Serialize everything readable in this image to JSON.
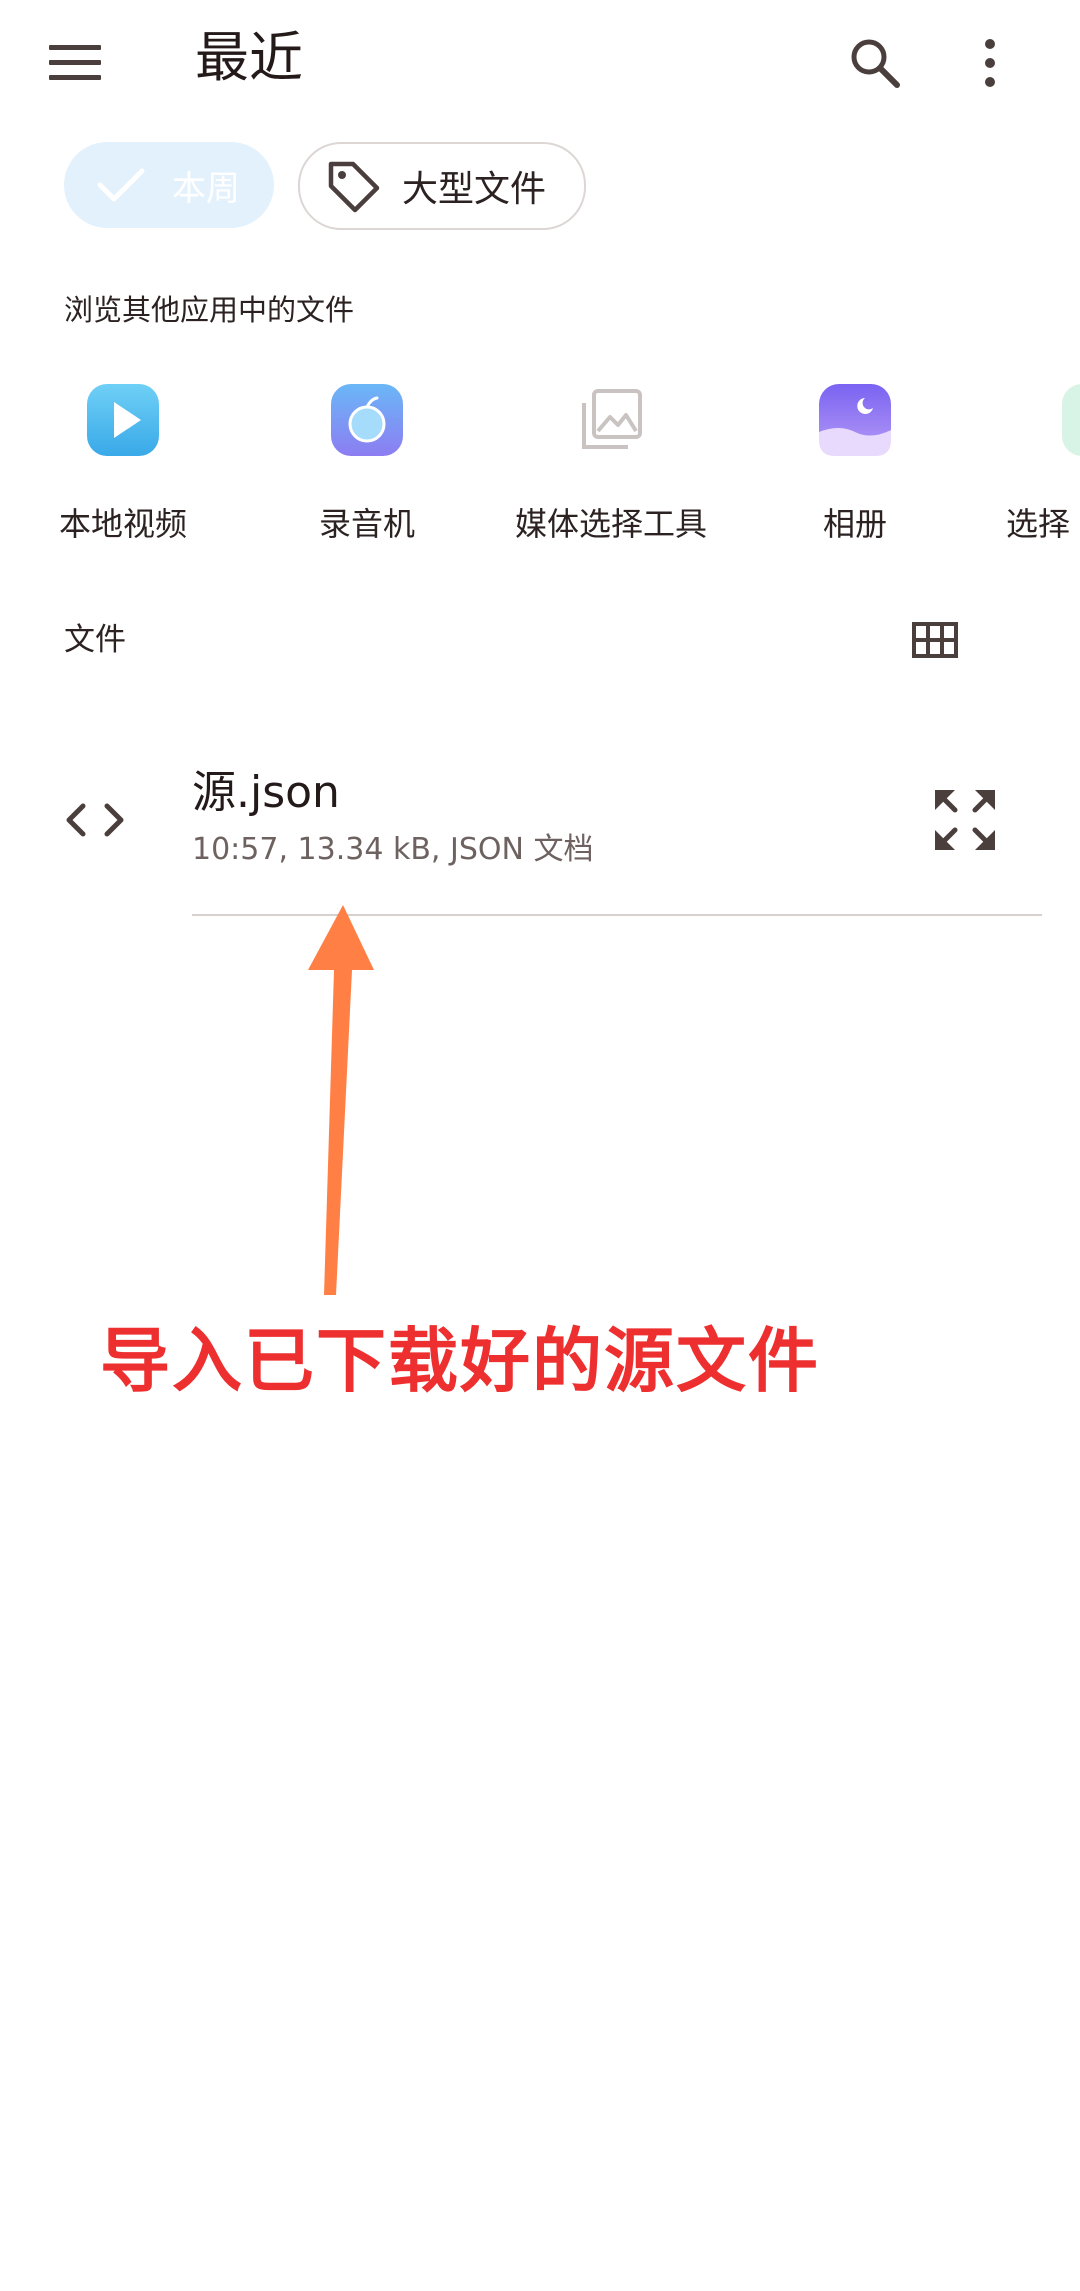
{
  "appbar": {
    "title": "最近",
    "icons": {
      "menu": "menu-icon",
      "search": "search-icon",
      "more": "more-vert-icon"
    }
  },
  "chips": [
    {
      "label": "本周",
      "icon": "check-icon",
      "selected": true
    },
    {
      "label": "大型文件",
      "icon": "tag-icon",
      "selected": false
    }
  ],
  "browse": {
    "title": "浏览其他应用中的文件",
    "apps": [
      {
        "label": "本地视频",
        "icon": "play-video-icon"
      },
      {
        "label": "录音机",
        "icon": "recorder-apple-icon"
      },
      {
        "label": "媒体选择工具",
        "icon": "photo-library-icon"
      },
      {
        "label": "相册",
        "icon": "gallery-moon-icon"
      },
      {
        "label": "选择",
        "icon": "app-icon"
      }
    ]
  },
  "files": {
    "title": "文件",
    "view_icon": "grid-view-icon",
    "items": [
      {
        "name": "源.json",
        "meta": "10:57, 13.34 kB, JSON 文档",
        "icon": "code-icon",
        "action_icon": "expand-icon"
      }
    ]
  },
  "annotation": {
    "text": "导入已下载好的源文件",
    "color": "#ee2f2f",
    "arrow_color": "#ff7f45"
  },
  "colors": {
    "accent_chip": "#e3f1fc",
    "text_primary": "#231a19",
    "text_secondary": "#6d6260"
  }
}
